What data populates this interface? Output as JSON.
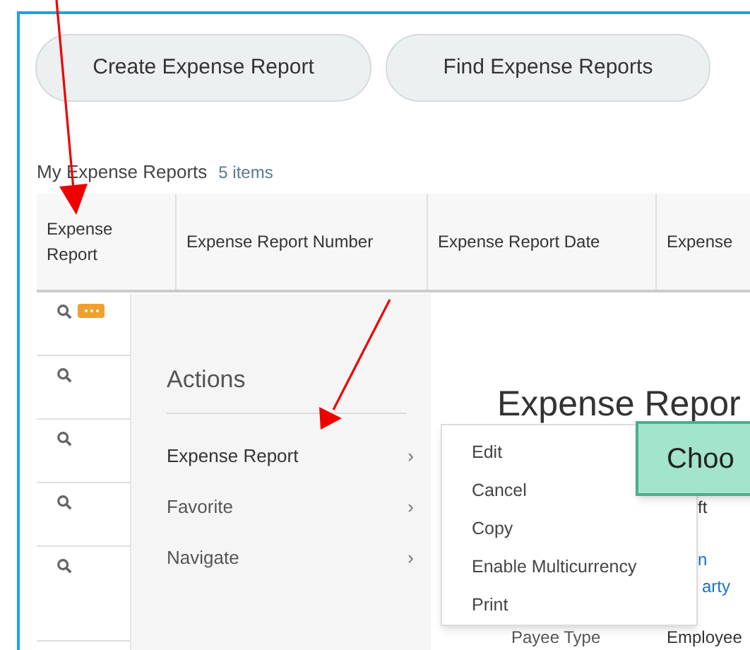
{
  "buttons": [
    "Create Expense Report",
    "Find Expense Reports"
  ],
  "section": {
    "title": "My Expense Reports",
    "count": "5 items"
  },
  "table": {
    "columns": [
      "Expense Report",
      "Expense Report Number",
      "Expense Report Date",
      "Expense"
    ],
    "rows": [
      {
        "related_actions": true
      },
      {
        "related_actions": false
      },
      {
        "related_actions": false
      },
      {
        "related_actions": false
      },
      {
        "related_actions": false
      }
    ]
  },
  "actions_menu": {
    "title": "Actions",
    "items": [
      {
        "label": "Expense Report",
        "chevron": "›",
        "expanded": true
      },
      {
        "label": "Favorite",
        "chevron": "›",
        "expanded": false
      },
      {
        "label": "Navigate",
        "chevron": "›",
        "expanded": false
      }
    ]
  },
  "submenu": {
    "items": [
      "Edit",
      "Cancel",
      "Copy",
      "Enable Multicurrency",
      "Print"
    ]
  },
  "detail": {
    "title": "Expense Repor",
    "fragments": [
      {
        "text": "ft",
        "kind": "plain"
      },
      {
        "text": "n",
        "kind": "link"
      },
      {
        "text": "arty",
        "kind": "link"
      },
      {
        "text": "Payee Type",
        "kind": "label"
      },
      {
        "text": "Employee",
        "kind": "plain"
      }
    ]
  },
  "callout": {
    "text": "Choo"
  }
}
